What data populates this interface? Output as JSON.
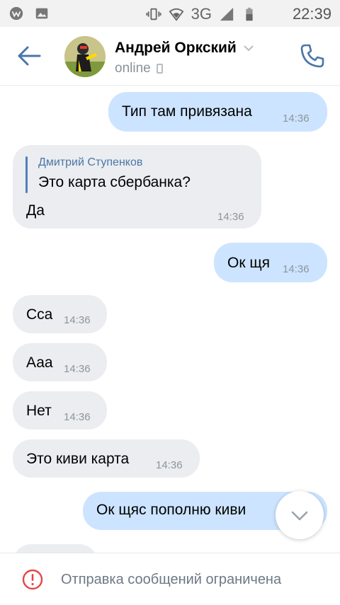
{
  "status_bar": {
    "network": "3G",
    "time": "22:39"
  },
  "header": {
    "contact_name": "Андрей Оркский",
    "status": "online"
  },
  "messages": [
    {
      "text": "Тип там привязана",
      "time": "14:36"
    },
    {
      "reply_author": "Дмитрий Ступенков",
      "reply_text": "Это карта сбербанка?",
      "text": "Да",
      "time": "14:36"
    },
    {
      "text": "Ок щя",
      "time": "14:36"
    },
    {
      "text": "Сса",
      "time": "14:36"
    },
    {
      "text": "Ааа",
      "time": "14:36"
    },
    {
      "text": "Нет",
      "time": "14:36"
    },
    {
      "text": "Это киви карта",
      "time": "14:36"
    },
    {
      "text": "Ок щяс пополню киви"
    }
  ],
  "bottom_bar": {
    "notice": "Отправка сообщений ограничена"
  },
  "colors": {
    "accent": "#4a76a8",
    "outgoing_bubble": "#cce4ff",
    "incoming_bubble": "#ebedf0",
    "warning": "#e64646"
  }
}
